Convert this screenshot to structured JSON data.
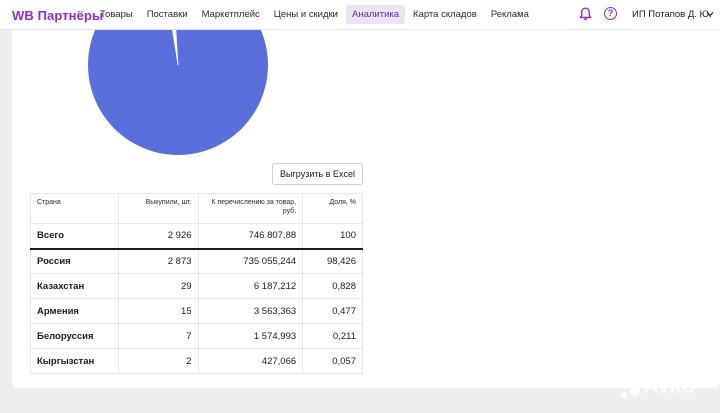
{
  "brand": "WB Партнёры",
  "nav": [
    {
      "label": "Товары"
    },
    {
      "label": "Поставки"
    },
    {
      "label": "Маркетплейс"
    },
    {
      "label": "Цены и скидки"
    },
    {
      "label": "Аналитика"
    },
    {
      "label": "Карта складов"
    },
    {
      "label": "Реклама"
    }
  ],
  "active_nav": "Аналитика",
  "user": "ИП Потапов Д. Ю.",
  "export_button": "Выгрузить в Excel",
  "table": {
    "headers": [
      "Страна",
      "Выкупили, шт.",
      "К перечислению за товар, руб.",
      "Доля, %"
    ],
    "total": {
      "country": "Всего",
      "qty": "2 926",
      "amount": "746 807,88",
      "share": "100"
    },
    "rows": [
      {
        "country": "Россия",
        "qty": "2 873",
        "amount": "735 055,244",
        "share": "98,426"
      },
      {
        "country": "Казахстан",
        "qty": "29",
        "amount": "6 187,212",
        "share": "0,828"
      },
      {
        "country": "Армения",
        "qty": "15",
        "amount": "3 563,363",
        "share": "0,477"
      },
      {
        "country": "Белоруссия",
        "qty": "7",
        "amount": "1 574,993",
        "share": "0,211"
      },
      {
        "country": "Кыргызстан",
        "qty": "2",
        "amount": "427,066",
        "share": "0,057"
      }
    ]
  },
  "pie": {
    "color_main": "#5b6fdc",
    "slices": [
      {
        "name": "Россия",
        "share": 98.426
      },
      {
        "name": "Казахстан",
        "share": 0.828
      },
      {
        "name": "Армения",
        "share": 0.477
      },
      {
        "name": "Белоруссия",
        "share": 0.211
      },
      {
        "name": "Кыргызстан",
        "share": 0.057
      }
    ]
  },
  "colors": {
    "brand": "#8c2bd6",
    "accent_bg": "#ece4f5",
    "pie": "#5b6fdc"
  },
  "watermark": "Avito"
}
